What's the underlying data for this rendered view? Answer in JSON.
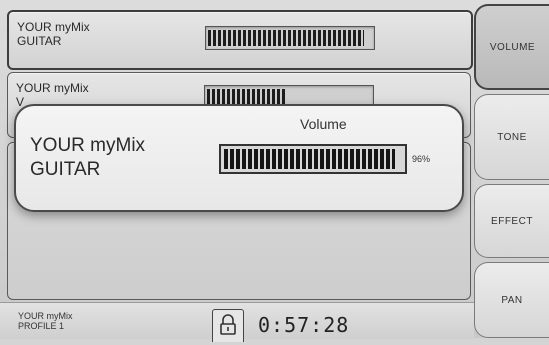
{
  "channels": [
    {
      "name": "YOUR myMix\nGUITAR",
      "level": 0.95
    },
    {
      "name": "YOUR myMix\nV",
      "level": 0.48
    }
  ],
  "popup": {
    "title": "Volume",
    "name_line1": "YOUR myMix",
    "name_line2": "GUITAR",
    "level": 0.96,
    "percent_label": "96%"
  },
  "tabs": {
    "volume": "VOLUME",
    "tone": "TONE",
    "effect": "EFFECT",
    "pan": "PAN",
    "active": "volume"
  },
  "status": {
    "line1": "YOUR myMix",
    "line2": "PROFILE 1",
    "lock_icon": "lock-icon",
    "time": "0:57:28"
  }
}
